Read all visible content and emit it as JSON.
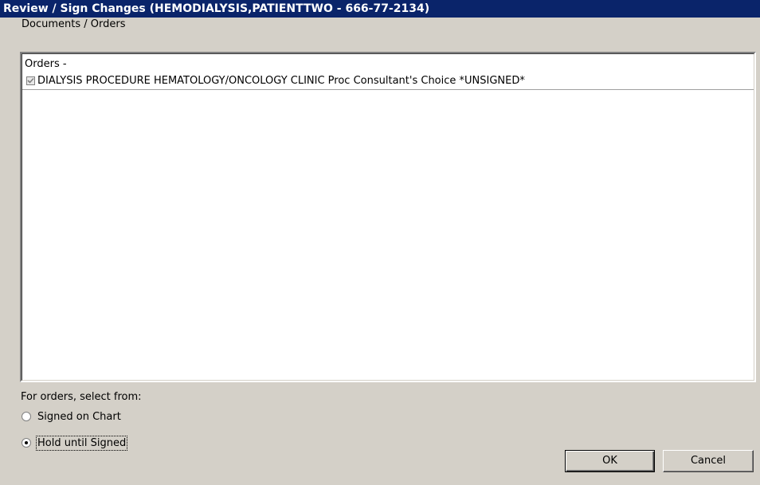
{
  "window": {
    "title": "Review / Sign Changes  (HEMODIALYSIS,PATIENTTWO - 666-77-2134)"
  },
  "section": {
    "label": "Documents / Orders"
  },
  "list": {
    "header": "Orders -",
    "items": [
      {
        "checked": true,
        "text": "DIALYSIS PROCEDURE HEMATOLOGY/ONCOLOGY CLINIC Proc Consultant's Choice *UNSIGNED*"
      }
    ]
  },
  "options": {
    "instruction": "For orders, select from:",
    "radios": [
      {
        "label": "Signed on Chart",
        "selected": false
      },
      {
        "label": "Hold until Signed",
        "selected": true
      }
    ]
  },
  "buttons": {
    "ok": "OK",
    "cancel": "Cancel"
  },
  "colors": {
    "titlebar": "#0a246a",
    "face": "#d4d0c8"
  }
}
